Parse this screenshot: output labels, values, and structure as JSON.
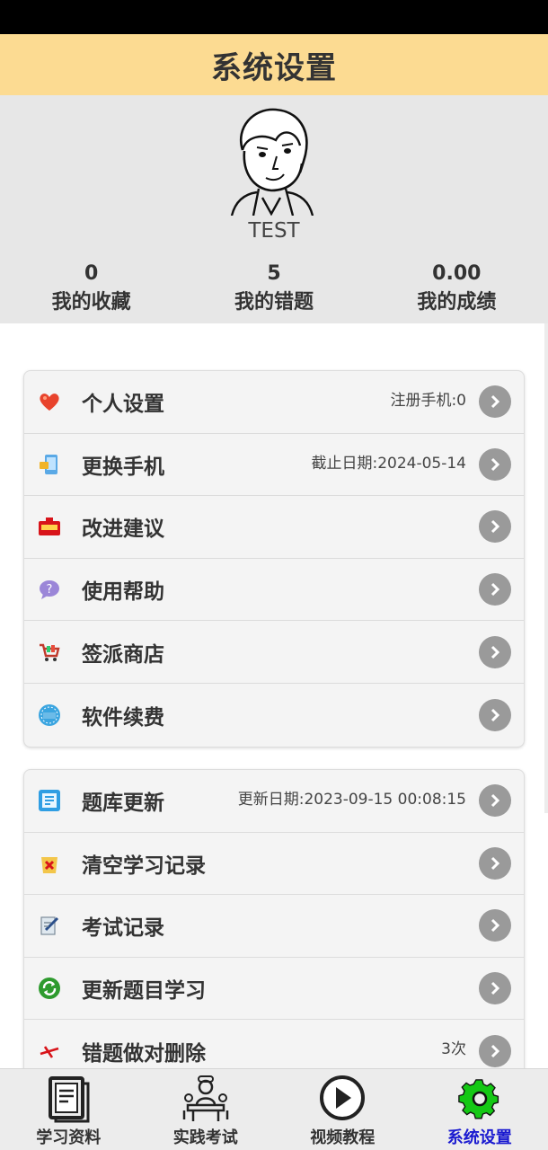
{
  "header": {
    "title": "系统设置"
  },
  "profile": {
    "username": "TEST",
    "stats": [
      {
        "value": "0",
        "label": "我的收藏"
      },
      {
        "value": "5",
        "label": "我的错题"
      },
      {
        "value": "0.00",
        "label": "我的成绩"
      }
    ]
  },
  "menu_group_1": [
    {
      "icon": "heart-icon",
      "label": "个人设置",
      "value": "注册手机:0"
    },
    {
      "icon": "phone-icon",
      "label": "更换手机",
      "value": "截止日期:2024-05-14"
    },
    {
      "icon": "suggestion-box-icon",
      "label": "改进建议",
      "value": ""
    },
    {
      "icon": "help-bubble-icon",
      "label": "使用帮助",
      "value": ""
    },
    {
      "icon": "shopping-cart-icon",
      "label": "签派商店",
      "value": ""
    },
    {
      "icon": "buy-now-icon",
      "label": "软件续费",
      "value": ""
    }
  ],
  "menu_group_2": [
    {
      "icon": "question-bank-icon",
      "label": "题库更新",
      "value": "更新日期:2023-09-15 00:08:15"
    },
    {
      "icon": "clear-record-icon",
      "label": "清空学习记录",
      "value": ""
    },
    {
      "icon": "exam-record-icon",
      "label": "考试记录",
      "value": ""
    },
    {
      "icon": "refresh-icon",
      "label": "更新题目学习",
      "value": ""
    },
    {
      "icon": "delete-wrong-icon",
      "label": "错题做对删除",
      "value": "3次"
    }
  ],
  "bottom_nav": [
    {
      "icon": "book-icon",
      "label": "学习资料"
    },
    {
      "icon": "practice-exam-icon",
      "label": "实践考试"
    },
    {
      "icon": "play-video-icon",
      "label": "视频教程"
    },
    {
      "icon": "gear-icon",
      "label": "系统设置"
    }
  ],
  "colors": {
    "header_bg": "#fcdb92",
    "active_nav": "#1a1ad0",
    "active_icon": "#14c814"
  }
}
